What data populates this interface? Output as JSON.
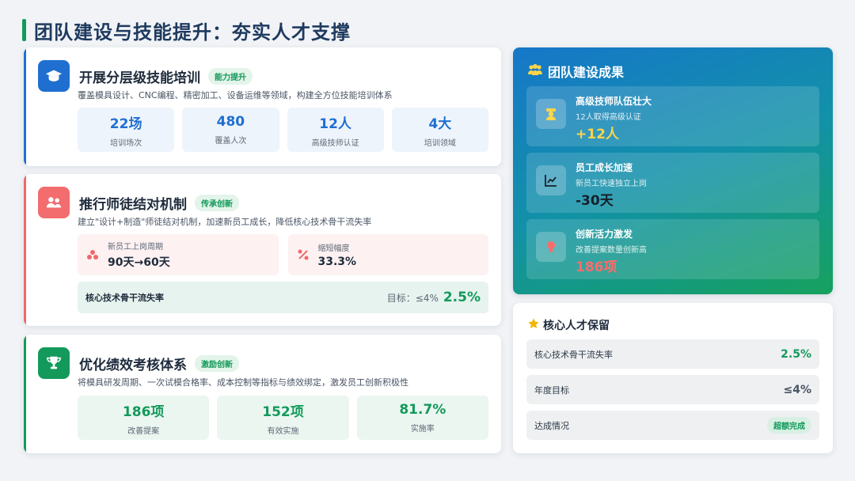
{
  "page_title": "团队建设与技能提升：夯实人才支撑",
  "cards": {
    "training": {
      "title": "开展分层级技能培训",
      "tag": "能力提升",
      "desc": "覆盖模具设计、CNC编程、精密加工、设备运维等领域，构建全方位技能培训体系",
      "accent": "#1f6fd1",
      "icon": "graduation-cap-icon",
      "stats": [
        {
          "value": "22场",
          "label": "培训场次"
        },
        {
          "value": "480",
          "label": "覆盖人次"
        },
        {
          "value": "12人",
          "label": "高级技师认证"
        },
        {
          "value": "4大",
          "label": "培训领域"
        }
      ]
    },
    "mentorship": {
      "title": "推行师徒结对机制",
      "tag": "传承创新",
      "desc": "建立\"设计+制造\"师徒结对机制，加速新员工成长，降低核心技术骨干流失率",
      "accent": "#f0686a",
      "icon": "people-icon",
      "cycle_label": "新员工上岗周期",
      "cycle_value": "90天→60天",
      "reduce_label": "缩短幅度",
      "reduce_value": "33.3%",
      "rate_label": "核心技术骨干流失率",
      "rate_target": "目标：≤4%",
      "rate_value": "2.5%"
    },
    "performance": {
      "title": "优化绩效考核体系",
      "tag": "激励创新",
      "desc": "将模具研发周期、一次试模合格率、成本控制等指标与绩效绑定，激发员工创新积极性",
      "accent": "#139a5b",
      "icon": "trophy-icon",
      "stats": [
        {
          "value": "186项",
          "label": "改善提案"
        },
        {
          "value": "152项",
          "label": "有效实施"
        },
        {
          "value": "81.7%",
          "label": "实施率"
        }
      ]
    }
  },
  "results": {
    "title": "团队建设成果",
    "items": [
      {
        "title": "高级技师队伍壮大",
        "sub": "12人取得高级认证",
        "value": "+12人",
        "color": "#ffd54a",
        "icon": "technician-icon"
      },
      {
        "title": "员工成长加速",
        "sub": "新员工快速独立上岗",
        "value": "-30天",
        "color": "#16202b",
        "icon": "trend-chart-icon"
      },
      {
        "title": "创新活力激发",
        "sub": "改善提案数量创新高",
        "value": "186项",
        "color": "#ff6b6b",
        "icon": "lightbulb-icon"
      }
    ]
  },
  "retention": {
    "title": "核心人才保留",
    "rows": [
      {
        "key": "核心技术骨干流失率",
        "value": "2.5%",
        "color": "#139a5b"
      },
      {
        "key": "年度目标",
        "value": "≤4%",
        "color": "#4a5564"
      },
      {
        "key": "达成情况",
        "badge": "超额完成"
      }
    ]
  }
}
